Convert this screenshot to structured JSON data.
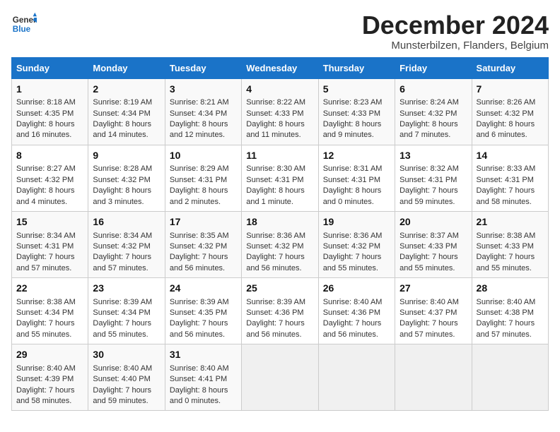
{
  "logo": {
    "line1": "General",
    "line2": "Blue"
  },
  "title": "December 2024",
  "location": "Munsterbilzen, Flanders, Belgium",
  "days_of_week": [
    "Sunday",
    "Monday",
    "Tuesday",
    "Wednesday",
    "Thursday",
    "Friday",
    "Saturday"
  ],
  "weeks": [
    [
      {
        "day": "1",
        "rise": "8:18 AM",
        "set": "4:35 PM",
        "daylight": "8 hours and 16 minutes."
      },
      {
        "day": "2",
        "rise": "8:19 AM",
        "set": "4:34 PM",
        "daylight": "8 hours and 14 minutes."
      },
      {
        "day": "3",
        "rise": "8:21 AM",
        "set": "4:34 PM",
        "daylight": "8 hours and 12 minutes."
      },
      {
        "day": "4",
        "rise": "8:22 AM",
        "set": "4:33 PM",
        "daylight": "8 hours and 11 minutes."
      },
      {
        "day": "5",
        "rise": "8:23 AM",
        "set": "4:33 PM",
        "daylight": "8 hours and 9 minutes."
      },
      {
        "day": "6",
        "rise": "8:24 AM",
        "set": "4:32 PM",
        "daylight": "8 hours and 7 minutes."
      },
      {
        "day": "7",
        "rise": "8:26 AM",
        "set": "4:32 PM",
        "daylight": "8 hours and 6 minutes."
      }
    ],
    [
      {
        "day": "8",
        "rise": "8:27 AM",
        "set": "4:32 PM",
        "daylight": "8 hours and 4 minutes."
      },
      {
        "day": "9",
        "rise": "8:28 AM",
        "set": "4:32 PM",
        "daylight": "8 hours and 3 minutes."
      },
      {
        "day": "10",
        "rise": "8:29 AM",
        "set": "4:31 PM",
        "daylight": "8 hours and 2 minutes."
      },
      {
        "day": "11",
        "rise": "8:30 AM",
        "set": "4:31 PM",
        "daylight": "8 hours and 1 minute."
      },
      {
        "day": "12",
        "rise": "8:31 AM",
        "set": "4:31 PM",
        "daylight": "8 hours and 0 minutes."
      },
      {
        "day": "13",
        "rise": "8:32 AM",
        "set": "4:31 PM",
        "daylight": "7 hours and 59 minutes."
      },
      {
        "day": "14",
        "rise": "8:33 AM",
        "set": "4:31 PM",
        "daylight": "7 hours and 58 minutes."
      }
    ],
    [
      {
        "day": "15",
        "rise": "8:34 AM",
        "set": "4:31 PM",
        "daylight": "7 hours and 57 minutes."
      },
      {
        "day": "16",
        "rise": "8:34 AM",
        "set": "4:32 PM",
        "daylight": "7 hours and 57 minutes."
      },
      {
        "day": "17",
        "rise": "8:35 AM",
        "set": "4:32 PM",
        "daylight": "7 hours and 56 minutes."
      },
      {
        "day": "18",
        "rise": "8:36 AM",
        "set": "4:32 PM",
        "daylight": "7 hours and 56 minutes."
      },
      {
        "day": "19",
        "rise": "8:36 AM",
        "set": "4:32 PM",
        "daylight": "7 hours and 55 minutes."
      },
      {
        "day": "20",
        "rise": "8:37 AM",
        "set": "4:33 PM",
        "daylight": "7 hours and 55 minutes."
      },
      {
        "day": "21",
        "rise": "8:38 AM",
        "set": "4:33 PM",
        "daylight": "7 hours and 55 minutes."
      }
    ],
    [
      {
        "day": "22",
        "rise": "8:38 AM",
        "set": "4:34 PM",
        "daylight": "7 hours and 55 minutes."
      },
      {
        "day": "23",
        "rise": "8:39 AM",
        "set": "4:34 PM",
        "daylight": "7 hours and 55 minutes."
      },
      {
        "day": "24",
        "rise": "8:39 AM",
        "set": "4:35 PM",
        "daylight": "7 hours and 56 minutes."
      },
      {
        "day": "25",
        "rise": "8:39 AM",
        "set": "4:36 PM",
        "daylight": "7 hours and 56 minutes."
      },
      {
        "day": "26",
        "rise": "8:40 AM",
        "set": "4:36 PM",
        "daylight": "7 hours and 56 minutes."
      },
      {
        "day": "27",
        "rise": "8:40 AM",
        "set": "4:37 PM",
        "daylight": "7 hours and 57 minutes."
      },
      {
        "day": "28",
        "rise": "8:40 AM",
        "set": "4:38 PM",
        "daylight": "7 hours and 57 minutes."
      }
    ],
    [
      {
        "day": "29",
        "rise": "8:40 AM",
        "set": "4:39 PM",
        "daylight": "7 hours and 58 minutes."
      },
      {
        "day": "30",
        "rise": "8:40 AM",
        "set": "4:40 PM",
        "daylight": "7 hours and 59 minutes."
      },
      {
        "day": "31",
        "rise": "8:40 AM",
        "set": "4:41 PM",
        "daylight": "8 hours and 0 minutes."
      },
      {
        "day": "",
        "rise": "",
        "set": "",
        "daylight": ""
      },
      {
        "day": "",
        "rise": "",
        "set": "",
        "daylight": ""
      },
      {
        "day": "",
        "rise": "",
        "set": "",
        "daylight": ""
      },
      {
        "day": "",
        "rise": "",
        "set": "",
        "daylight": ""
      }
    ]
  ]
}
